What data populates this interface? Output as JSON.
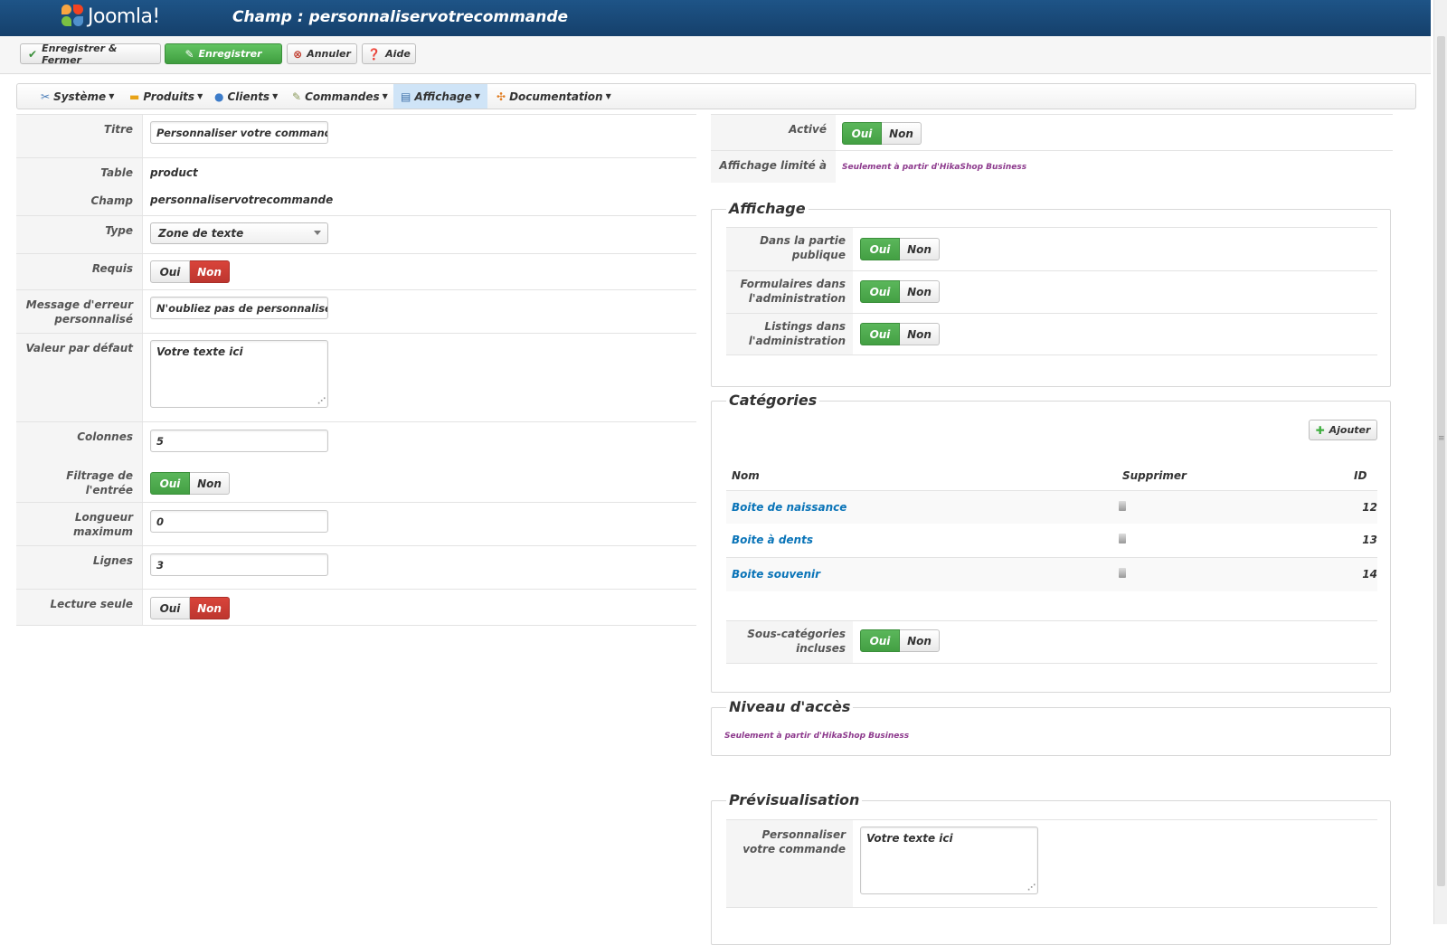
{
  "header": {
    "logo_text": "Joomla!",
    "title": "Champ : personnaliservotrecommande"
  },
  "toolbar": {
    "save_close": "Enregistrer & Fermer",
    "save": "Enregistrer",
    "cancel": "Annuler",
    "help": "Aide"
  },
  "menu": {
    "items": [
      {
        "label": "Système",
        "icon": "wrench-icon"
      },
      {
        "label": "Produits",
        "icon": "products-icon"
      },
      {
        "label": "Clients",
        "icon": "users-icon"
      },
      {
        "label": "Commandes",
        "icon": "orders-icon"
      },
      {
        "label": "Affichage",
        "icon": "display-icon"
      },
      {
        "label": "Documentation",
        "icon": "help-icon"
      }
    ],
    "active": "Affichage"
  },
  "form": {
    "titre_label": "Titre",
    "titre_value": "Personnaliser votre commande",
    "table_label": "Table",
    "table_value": "product",
    "champ_label": "Champ",
    "champ_value": "personnaliservotrecommande",
    "type_label": "Type",
    "type_value": "Zone de texte",
    "requis_label": "Requis",
    "error_label": "Message d'erreur personnalisé",
    "error_value": "N'oubliez pas de personnaliser",
    "default_label": "Valeur par défaut",
    "default_value": "Votre texte ici",
    "colonnes_label": "Colonnes",
    "colonnes_value": "5",
    "filtrage_label": "Filtrage de l'entrée",
    "longueur_label": "Longueur maximum",
    "longueur_value": "0",
    "lignes_label": "Lignes",
    "lignes_value": "3",
    "lecture_label": "Lecture seule"
  },
  "toggle": {
    "yes": "Oui",
    "no": "Non"
  },
  "right": {
    "active_label": "Activé",
    "limited_label": "Affichage limité à",
    "business_notice": "Seulement à partir d'HikaShop Business",
    "affichage_legend": "Affichage",
    "public_label": "Dans la partie publique",
    "admin_forms_label": "Formulaires dans l'administration",
    "admin_list_label": "Listings dans l'administration",
    "categories_legend": "Catégories",
    "add_label": "Ajouter",
    "col_name": "Nom",
    "col_delete": "Supprimer",
    "col_id": "ID",
    "categories": [
      {
        "name": "Boite de naissance",
        "id": "12"
      },
      {
        "name": "Boite à dents",
        "id": "13"
      },
      {
        "name": "Boite souvenir",
        "id": "14"
      }
    ],
    "subcat_label": "Sous-catégories incluses",
    "access_legend": "Niveau d'accès",
    "preview_legend": "Prévisualisation",
    "preview_label": "Personnaliser votre commande",
    "preview_value": "Votre texte ici"
  }
}
